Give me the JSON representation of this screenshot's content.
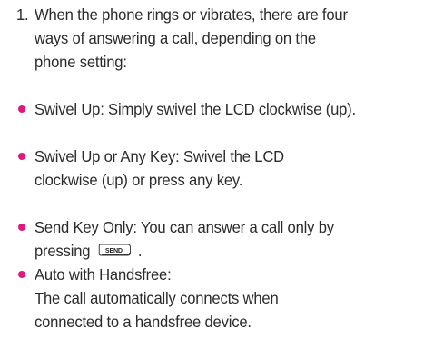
{
  "intro": {
    "number": "1.",
    "lines": [
      "When the phone rings or vibrates, there are four",
      "ways of answering a call, depending on the",
      "phone setting:"
    ]
  },
  "options": [
    {
      "lines": [
        "Swivel Up: Simply swivel the LCD clockwise (up)."
      ]
    },
    {
      "lines": [
        "Swivel Up or Any Key:  Swivel the LCD",
        "clockwise (up) or press any key."
      ]
    },
    {
      "lines": [
        "Send Key Only: You can answer a call only by",
        "pressing",
        "."
      ]
    },
    {
      "lines": [
        "Auto with Handsfree:",
        "The call automatically connects when",
        "connected to a handsfree device."
      ]
    }
  ],
  "send_key": {
    "label": "SEND"
  },
  "colors": {
    "bullet": "#e0197d",
    "text": "#2b2b2b"
  }
}
